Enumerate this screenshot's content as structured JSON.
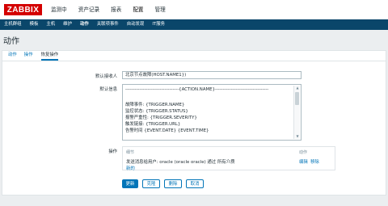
{
  "brand": {
    "logo": "ZABBIX"
  },
  "top_menu": [
    "监测中",
    "资产记录",
    "报表",
    "配置",
    "管理"
  ],
  "sub_menu": [
    "主机群组",
    "模板",
    "主机",
    "维护",
    "动作",
    "关联项事件",
    "自动发现",
    "IT服务"
  ],
  "page": {
    "title": "动作"
  },
  "tabs": [
    "动作",
    "操作",
    "恢复操作"
  ],
  "form": {
    "default_recipient_label": "默认接收人",
    "default_recipient_value": "北京节点故障(HOST.NAME1})",
    "default_message_label": "默认信息",
    "message_lines": [
      "----------------------------------{ACTION.NAME}----------------------------------",
      "",
      "故障事件: {TRIGGER.NAME}",
      "监控状态: {TRIGGER.STATUS}",
      "报警严重性: {TRIGGER.SEVERITY}",
      "触发链接: {TRIGGER.URL}",
      "告警时间 {EVENT.DATE} {EVENT.TIME}"
    ],
    "operations_label": "操作",
    "ops_details_header": "细节",
    "ops_action_header": "动作",
    "ops_row_text": "发送消息给用户: oracle (oracle oracle) 通过 所有介质",
    "ops_edit": "编辑",
    "ops_remove": "移除",
    "ops_new": "新的"
  },
  "buttons": {
    "update": "更新",
    "clone": "克隆",
    "delete": "删除",
    "cancel": "取消"
  },
  "colors": {
    "brand_red": "#d40000",
    "nav_blue": "#0a466a",
    "link_blue": "#0275b8"
  }
}
